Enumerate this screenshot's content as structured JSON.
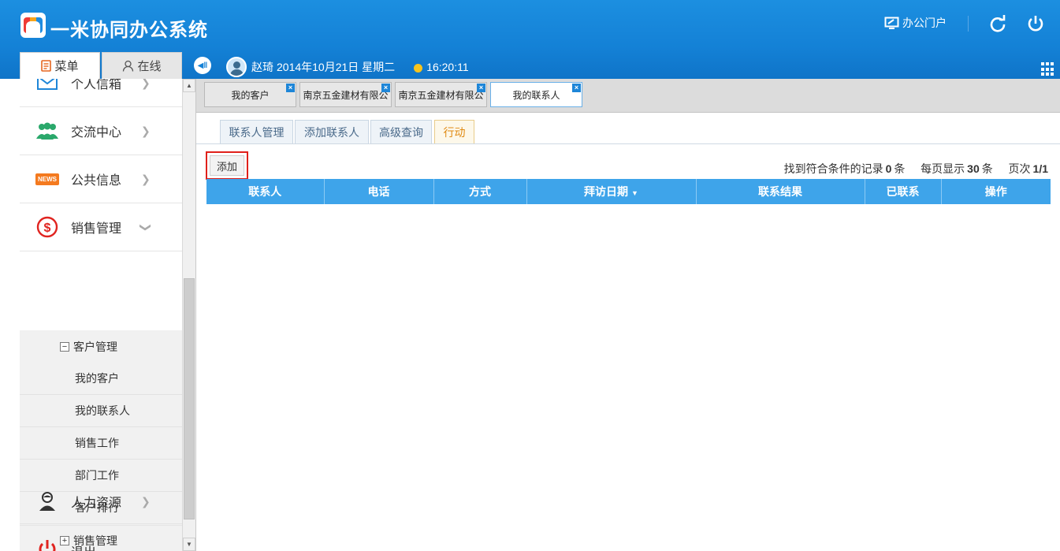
{
  "header": {
    "app_title": "一米协同办公系统",
    "portal_label": "办公门户",
    "user_name": "赵琦",
    "date_text": "2014年10月21日 星期二",
    "time_text": "16:20:11",
    "brand_color": "#1481d6"
  },
  "left_tabs": {
    "menu_label": "菜单",
    "online_label": "在线"
  },
  "sidebar": {
    "items": [
      {
        "label": "个人信箱",
        "icon": "mail-icon"
      },
      {
        "label": "交流中心",
        "icon": "people-icon"
      },
      {
        "label": "公共信息",
        "icon": "news-icon"
      },
      {
        "label": "销售管理",
        "icon": "dollar-icon"
      },
      {
        "label": "人力资源",
        "icon": "person-icon"
      },
      {
        "label": "退出",
        "icon": "power-icon"
      }
    ],
    "news_badge": "NEWS",
    "submenu": {
      "group_open": "客户管理",
      "items": [
        "我的客户",
        "我的联系人",
        "销售工作",
        "部门工作",
        "客户排行"
      ],
      "group_closed": "销售管理"
    }
  },
  "page_tabs": [
    {
      "label": "我的客户",
      "active": false
    },
    {
      "label": "南京五金建材有限公",
      "active": false
    },
    {
      "label": "南京五金建材有限公",
      "active": false
    },
    {
      "label": "我的联系人",
      "active": true
    }
  ],
  "sub_tabs": [
    {
      "label": "联系人管理",
      "active": false
    },
    {
      "label": "添加联系人",
      "active": false
    },
    {
      "label": "高级查询",
      "active": false
    },
    {
      "label": "行动",
      "active": true
    }
  ],
  "toolbar": {
    "add_label": "添加"
  },
  "records": {
    "prefix": "找到符合条件的记录",
    "count": "0",
    "unit": "条",
    "per_page_prefix": "每页显示",
    "per_page": "30",
    "per_page_unit": "条",
    "page_prefix": "页次",
    "page": "1/1"
  },
  "table": {
    "columns": [
      "联系人",
      "电话",
      "方式",
      "拜访日期",
      "联系结果",
      "已联系",
      "操作"
    ],
    "rows": []
  }
}
